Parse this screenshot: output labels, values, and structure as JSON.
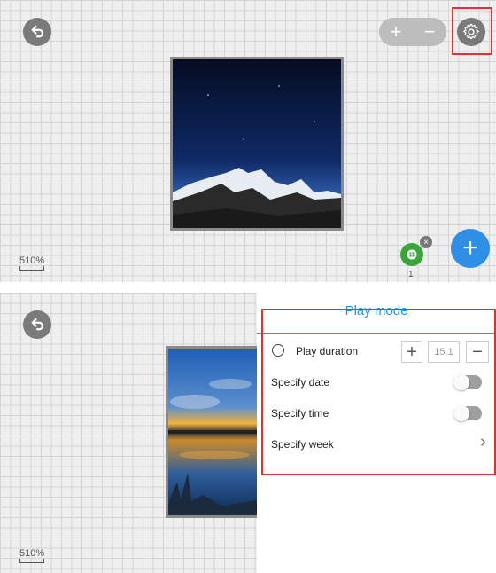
{
  "top_panel": {
    "zoom": {
      "plus_label": "+",
      "minus_label": "−"
    },
    "scale_label": "510%",
    "plugin_count": "1",
    "plugin_close": "×",
    "add_label": "+"
  },
  "bottom_panel": {
    "scale_label": "510%",
    "settings": {
      "title": "Play mode",
      "play_duration": {
        "label": "Play duration",
        "plus": "+",
        "value": "15.1",
        "minus": "−"
      },
      "specify_date": {
        "label": "Specify date",
        "enabled": false
      },
      "specify_time": {
        "label": "Specify time",
        "enabled": false
      },
      "specify_week": {
        "label": "Specify week",
        "chevron": "›"
      }
    }
  },
  "colors": {
    "accent": "#2196f3",
    "highlight": "#e03030",
    "add_button": "#2f8fe6",
    "plugin": "#3aa63a"
  }
}
